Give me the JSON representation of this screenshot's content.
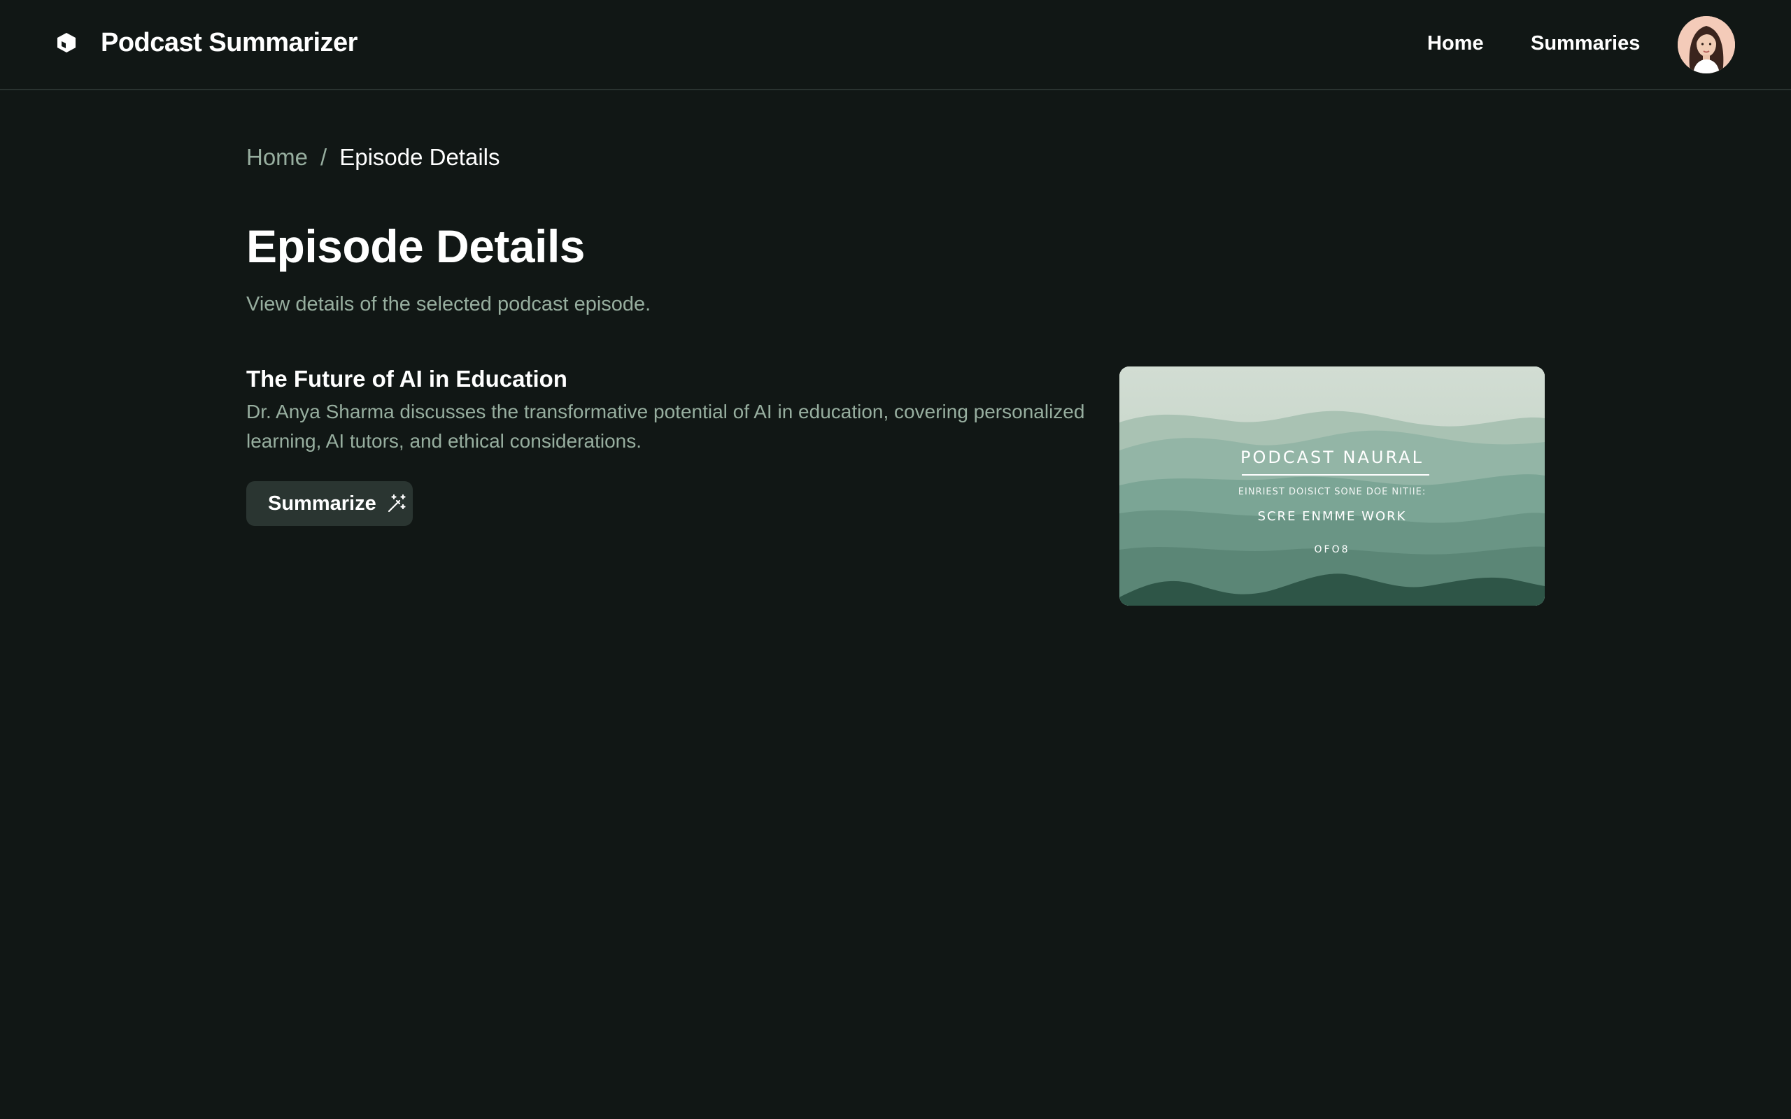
{
  "header": {
    "app_title": "Podcast Summarizer",
    "logo_icon": "cube-icon",
    "nav": [
      {
        "label": "Home"
      },
      {
        "label": "Summaries"
      }
    ],
    "avatar_icon": "user-avatar"
  },
  "breadcrumb": {
    "home": "Home",
    "separator": "/",
    "current": "Episode Details"
  },
  "page": {
    "title": "Episode Details",
    "subtitle": "View details of the selected podcast episode."
  },
  "episode": {
    "title": "The Future of AI in Education",
    "description": "Dr. Anya Sharma discusses the transformative potential of AI in education, covering personalized learning, AI tutors, and ethical considerations.",
    "summarize_label": "Summarize",
    "summarize_icon": "magic-wand-icon",
    "cover": {
      "line1": "PODCAST NAURAL",
      "line2": "EINRIEST DOISICT SONE DOE NITIIE:",
      "line3": "SCRE ENMME WORK",
      "line4": "OFO8"
    }
  },
  "colors": {
    "background": "#111715",
    "muted_text": "#97ae9f",
    "button_bg": "#2a3531",
    "divider": "#2a3330"
  }
}
